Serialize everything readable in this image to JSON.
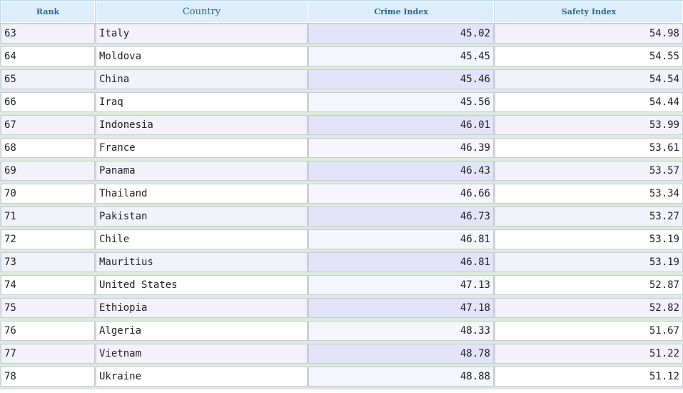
{
  "columns": {
    "rank": "Rank",
    "country": "Country",
    "crime": "Crime Index",
    "safety": "Safety Index"
  },
  "rows": [
    {
      "rank": "63",
      "country": "Italy",
      "crime": "45.02",
      "safety": "54.98"
    },
    {
      "rank": "64",
      "country": "Moldova",
      "crime": "45.45",
      "safety": "54.55"
    },
    {
      "rank": "65",
      "country": "China",
      "crime": "45.46",
      "safety": "54.54"
    },
    {
      "rank": "66",
      "country": "Iraq",
      "crime": "45.56",
      "safety": "54.44"
    },
    {
      "rank": "67",
      "country": "Indonesia",
      "crime": "46.01",
      "safety": "53.99"
    },
    {
      "rank": "68",
      "country": "France",
      "crime": "46.39",
      "safety": "53.61"
    },
    {
      "rank": "69",
      "country": "Panama",
      "crime": "46.43",
      "safety": "53.57"
    },
    {
      "rank": "70",
      "country": "Thailand",
      "crime": "46.66",
      "safety": "53.34"
    },
    {
      "rank": "71",
      "country": "Pakistan",
      "crime": "46.73",
      "safety": "53.27"
    },
    {
      "rank": "72",
      "country": "Chile",
      "crime": "46.81",
      "safety": "53.19"
    },
    {
      "rank": "73",
      "country": "Mauritius",
      "crime": "46.81",
      "safety": "53.19"
    },
    {
      "rank": "74",
      "country": "United States",
      "crime": "47.13",
      "safety": "52.87"
    },
    {
      "rank": "75",
      "country": "Ethiopia",
      "crime": "47.18",
      "safety": "52.82"
    },
    {
      "rank": "76",
      "country": "Algeria",
      "crime": "48.33",
      "safety": "51.67"
    },
    {
      "rank": "77",
      "country": "Vietnam",
      "crime": "48.78",
      "safety": "51.22"
    },
    {
      "rank": "78",
      "country": "Ukraine",
      "crime": "48.88",
      "safety": "51.12"
    }
  ]
}
